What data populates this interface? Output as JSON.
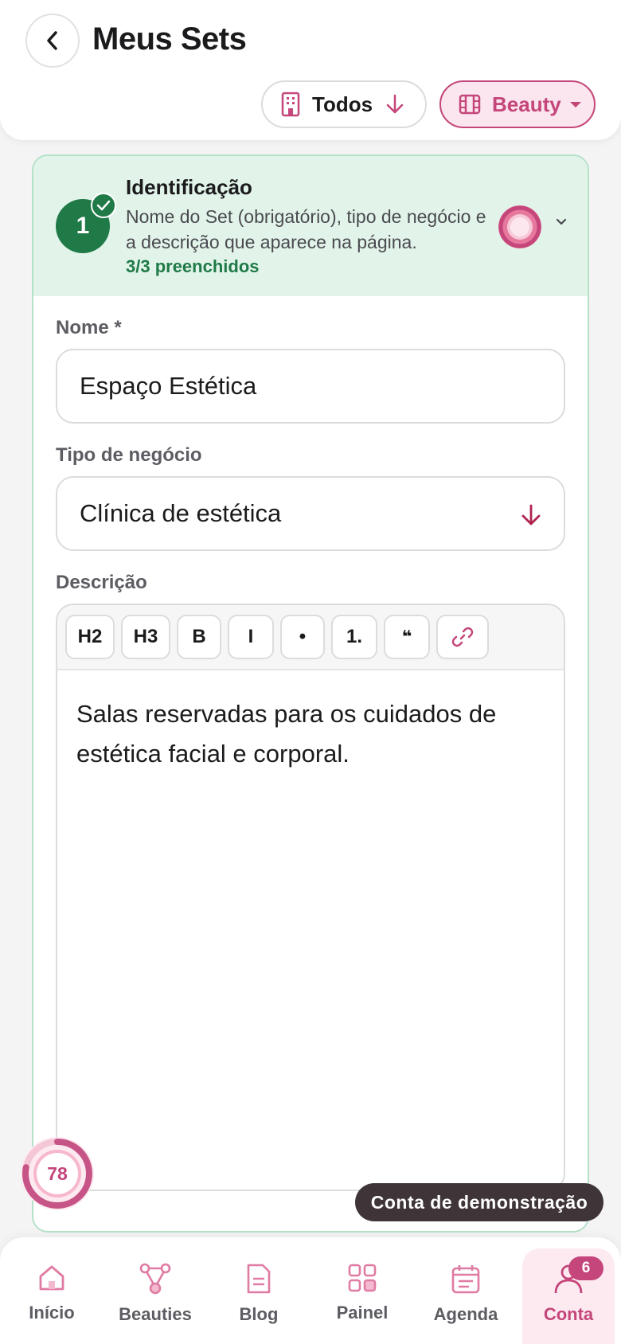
{
  "header": {
    "title": "Meus Sets",
    "filter_all_label": "Todos",
    "filter_brand_label": "Beauty"
  },
  "section": {
    "number": "1",
    "title": "Identificação",
    "description": "Nome do Set (obrigatório), tipo de negócio e a descrição que aparece na página.",
    "status": "3/3 preenchidos"
  },
  "form": {
    "name_label": "Nome *",
    "name_value": "Espaço Estética",
    "type_label": "Tipo de negócio",
    "type_value": "Clínica de estética",
    "description_label": "Descrição",
    "description_value": "Salas reservadas para os cuidados de estética facial e corporal."
  },
  "toolbar": {
    "h2": "H2",
    "h3": "H3",
    "bold": "B",
    "italic": "I",
    "bullet": "•",
    "ordered": "1.",
    "quote": "❝"
  },
  "progress": {
    "value": "78",
    "fraction": 0.78
  },
  "demo_label": "Conta de demonstração",
  "nav": {
    "items": [
      {
        "label": "Início",
        "icon": "home-icon"
      },
      {
        "label": "Beauties",
        "icon": "network-icon"
      },
      {
        "label": "Blog",
        "icon": "document-icon"
      },
      {
        "label": "Painel",
        "icon": "grid-icon"
      },
      {
        "label": "Agenda",
        "icon": "calendar-icon"
      },
      {
        "label": "Conta",
        "icon": "user-icon",
        "badge": "6",
        "active": true
      }
    ]
  },
  "colors": {
    "brand": "#c4467a",
    "success": "#1f7a47",
    "success_bg": "#e2f4ea"
  }
}
